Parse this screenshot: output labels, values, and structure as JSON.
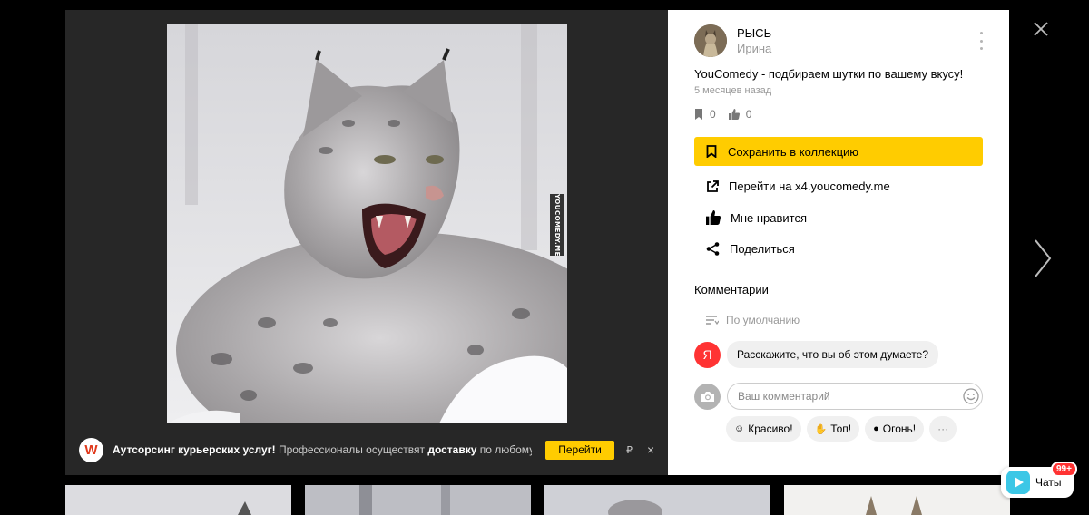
{
  "viewer": {
    "watermark": "YOUCOMEDY.ME",
    "ad": {
      "logo_letter": "W",
      "title": "Аутсорсинг курьерских услуг!",
      "text_part1": "Профессионалы осуществят",
      "text_bold": "доставку",
      "text_part2": "по любому …",
      "button": "Перейти",
      "currency_icon": "₽",
      "close": "×"
    }
  },
  "panel": {
    "channel_name": "РЫСЬ",
    "author": "Ирина",
    "description": "YouComedy - подбираем шутки по вашему вкусу!",
    "time": "5 месяцев назад",
    "saves_count": "0",
    "likes_count": "0",
    "save_button": "Сохранить в коллекцию",
    "actions": {
      "goto": "Перейти на x4.youcomedy.me",
      "like": "Мне нравится",
      "share": "Поделиться"
    },
    "comments_title": "Комментарии",
    "sort_label": "По умолчанию",
    "ya_letter": "Я",
    "prompt": "Расскажите, что вы об этом думаете?",
    "comment_placeholder": "Ваш комментарий",
    "chips": [
      {
        "icon": "☺",
        "label": "Красиво!"
      },
      {
        "icon": "✋",
        "label": "Топ!"
      },
      {
        "icon": "●",
        "label": "Огонь!"
      },
      {
        "icon": "",
        "label": "···"
      }
    ]
  },
  "chats": {
    "label": "Чаты",
    "badge": "99+"
  },
  "colors": {
    "accent": "#ffcc00",
    "viewer_bg": "#272727",
    "ya_red": "#ff3333"
  }
}
